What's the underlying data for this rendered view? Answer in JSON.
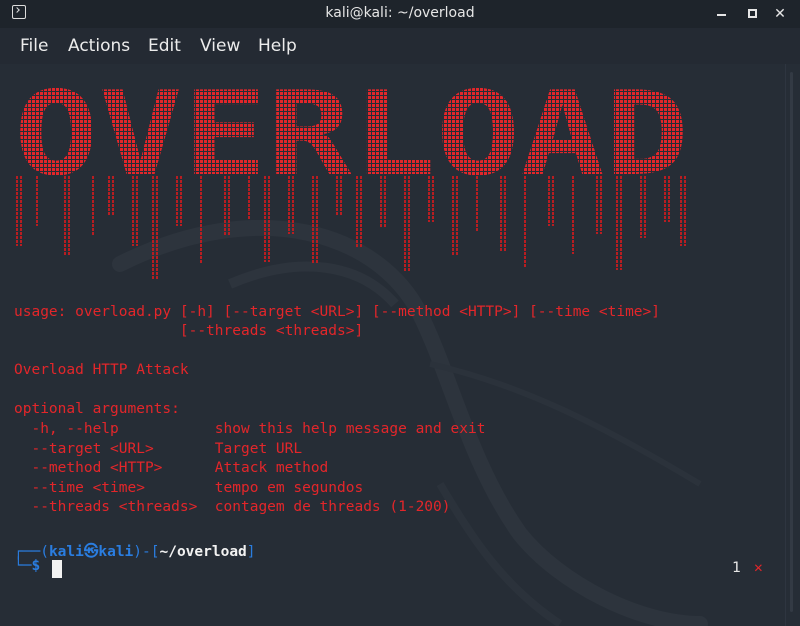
{
  "window": {
    "title": "kali@kali: ~/overload",
    "controls": [
      "minimize-icon",
      "maximize-icon",
      "close-icon"
    ]
  },
  "menu": {
    "items": [
      {
        "label": "File"
      },
      {
        "label": "Actions"
      },
      {
        "label": "Edit"
      },
      {
        "label": "View"
      },
      {
        "label": "Help"
      }
    ]
  },
  "banner": {
    "text": "OVERLOAD",
    "color": "#e3262a"
  },
  "help": {
    "usage_line1": "usage: overload.py [-h] [--target <URL>] [--method <HTTP>] [--time <time>]",
    "usage_line2": "                   [--threads <threads>]",
    "description": "Overload HTTP Attack",
    "optional_header": "optional arguments:",
    "args": [
      {
        "flag": "  -h, --help           ",
        "desc": "show this help message and exit"
      },
      {
        "flag": "  --target <URL>       ",
        "desc": "Target URL"
      },
      {
        "flag": "  --method <HTTP>      ",
        "desc": "Attack method"
      },
      {
        "flag": "  --time <time>        ",
        "desc": "tempo em segundos"
      },
      {
        "flag": "  --threads <threads>  ",
        "desc": "contagem de threads (1-200)"
      }
    ]
  },
  "prompt": {
    "corner_top": "┌──",
    "open_paren": "(",
    "user": "kali㉿kali",
    "close_paren": ")-[",
    "path": "~/overload",
    "close_bracket": "]",
    "corner_bottom": "└─",
    "dollar": "$"
  },
  "status": {
    "count": "1",
    "x": "✕"
  },
  "colors": {
    "terminal_bg": "#262d36",
    "accent_red": "#e3262a",
    "prompt_blue": "#2a7de0"
  }
}
